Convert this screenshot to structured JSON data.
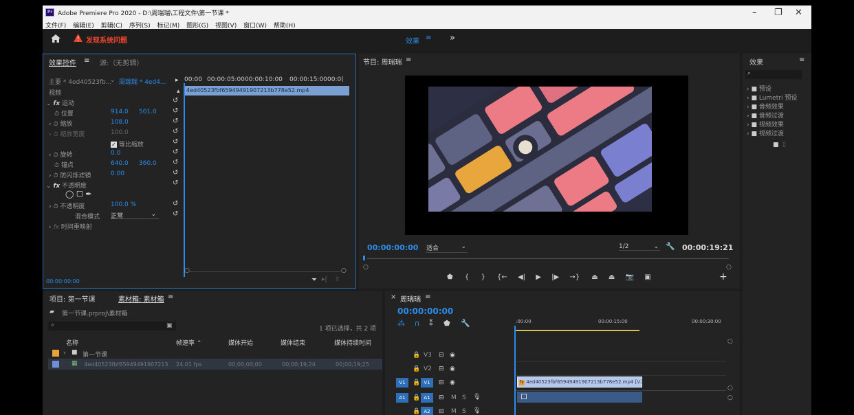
{
  "window": {
    "title": "Adobe Premiere Pro 2020 - D:\\周瑞瑞\\工程文件\\第一节课 *",
    "app_icon": "Pr",
    "controls": {
      "minimize": "–",
      "restore": "❐",
      "close": "✕"
    }
  },
  "menu": [
    "文件(F)",
    "编辑(E)",
    "剪辑(C)",
    "序列(S)",
    "标记(M)",
    "图形(G)",
    "视图(V)",
    "窗口(W)",
    "帮助(H)"
  ],
  "workspace": {
    "warning": "发现系统问题",
    "center_tab": "效果",
    "more": "»"
  },
  "effect_controls": {
    "tab_active": "效果控件",
    "tab_source": "源:（无剪辑）",
    "master": "主要 * 4ed40523fb...",
    "sequence_clip": "周瑞瑞 * 4ed4...",
    "section_video": "视频",
    "timecodes": [
      "00:00",
      "00:00:05:00",
      "00:00:10:00",
      "00:00:15:00",
      "00:0("
    ],
    "clip_bar": "4ed40523fbf65949491907213b778e52.mp4",
    "motion": "运动",
    "position_label": "位置",
    "position_x": "914.0",
    "position_y": "501.0",
    "scale_label": "缩放",
    "scale_value": "108.0",
    "scale_width_label": "缩放宽度",
    "scale_width_value": "100.0",
    "uniform_scale": "等比缩放",
    "rotation_label": "旋转",
    "rotation_value": "0.0",
    "anchor_label": "锚点",
    "anchor_x": "640.0",
    "anchor_y": "360.0",
    "flicker_label": "防闪烁滤镜",
    "flicker_value": "0.00",
    "opacity_section": "不透明度",
    "opacity_label": "不透明度",
    "opacity_value": "100.0 %",
    "blend_label": "混合模式",
    "blend_value": "正常",
    "time_remap": "时间重映射",
    "bottom_timecode": "00:00:00:00"
  },
  "program": {
    "title": "节目: 周瑞瑞",
    "timecode": "00:00:00:00",
    "fit": "适合",
    "resolution": "1/2",
    "duration": "00:00:19:21"
  },
  "effects_panel": {
    "title": "效果",
    "items": [
      "预设",
      "Lumetri 预设",
      "音频效果",
      "音频过渡",
      "视频效果",
      "视频过渡"
    ]
  },
  "project": {
    "tab_project": "项目: 第一节课",
    "tab_bin": "素材箱: 素材箱",
    "path": "第一节课.prproj\\素材箱",
    "selection_info": "1 项已选择，共 2 项",
    "columns": [
      "名称",
      "帧速率",
      "媒体开始",
      "媒体结束",
      "媒体持续时间"
    ],
    "rows": [
      {
        "name": "第一节课",
        "fps": "",
        "start": "",
        "end": "",
        "duration": "",
        "color": "#e8a33a"
      },
      {
        "name": "4ed40523fbf65949491907213",
        "fps": "24.01 fps",
        "start": "00;00;00;00",
        "end": "00;00;19;24",
        "duration": "00;00;19;25",
        "color": "#6f8fd6"
      }
    ]
  },
  "timeline": {
    "title": "周瑞瑞",
    "timecode": "00:00:00:00",
    "ruler": [
      ":00:00",
      "00:00:15:00",
      "00:00:30:00"
    ],
    "video_tracks": [
      "V3",
      "V2",
      "V1"
    ],
    "audio_tracks": [
      "A1",
      "A2"
    ],
    "v1_source": "V1",
    "a1_source": "A1",
    "clip_label": "4ed40523fbf65949491907213b778e52.mp4 [V]",
    "mute": "M",
    "solo": "S"
  },
  "colors": {
    "accent": "#2d8ceb",
    "warning": "#e8452c",
    "clip_video": "#b4c8f0",
    "clip_audio": "#3a5a8a"
  }
}
